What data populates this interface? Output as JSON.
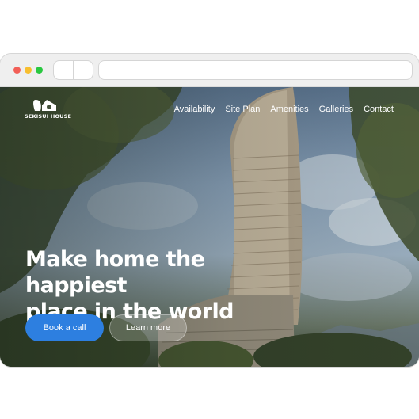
{
  "brand": {
    "name": "SEKISUI HOUSE"
  },
  "nav": {
    "items": [
      "Availability",
      "Site Plan",
      "Amenities",
      "Galleries",
      "Contact"
    ]
  },
  "hero": {
    "headline_line1": "Make home the happiest",
    "headline_line2": "place in the world",
    "primary_cta": "Book a call",
    "secondary_cta": "Learn more"
  },
  "colors": {
    "accent": "#2d7fe0",
    "traffic_red": "#f25f57",
    "traffic_yellow": "#f7be2f",
    "traffic_green": "#29c840"
  }
}
